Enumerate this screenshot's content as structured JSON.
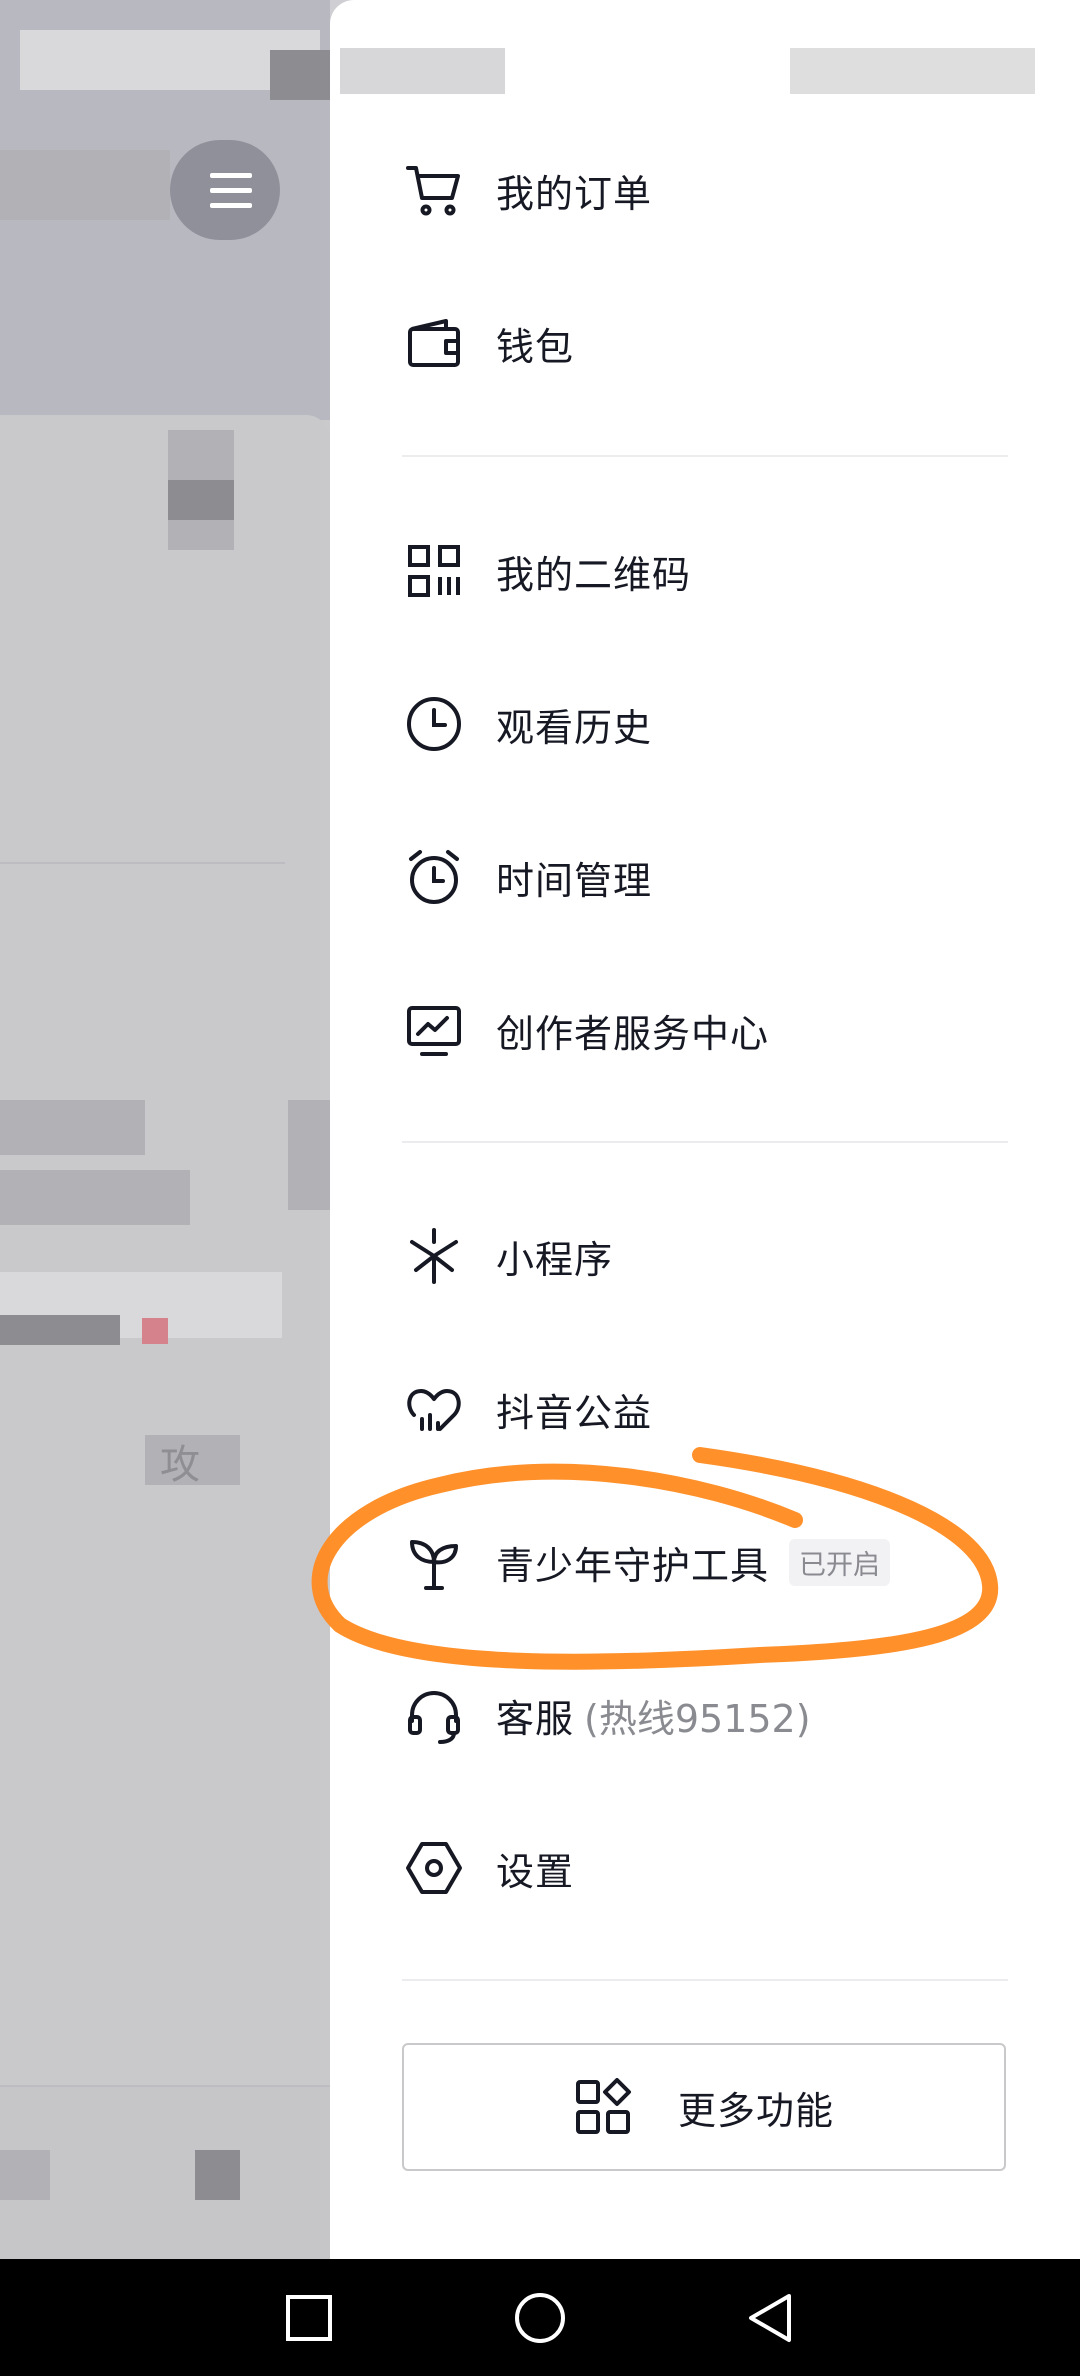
{
  "menu": {
    "items": [
      {
        "label": "我的订单",
        "icon": "cart-icon"
      },
      {
        "label": "钱包",
        "icon": "wallet-icon"
      },
      {
        "label": "我的二维码",
        "icon": "qr-code-icon"
      },
      {
        "label": "观看历史",
        "icon": "clock-icon"
      },
      {
        "label": "时间管理",
        "icon": "alarm-clock-icon"
      },
      {
        "label": "创作者服务中心",
        "icon": "creator-monitor-icon"
      },
      {
        "label": "小程序",
        "icon": "mini-program-icon"
      },
      {
        "label": "抖音公益",
        "icon": "charity-heart-icon"
      },
      {
        "label": "青少年守护工具",
        "icon": "sprout-icon",
        "badge": "已开启"
      },
      {
        "label": "客服",
        "icon": "headset-icon",
        "sub": "(热线95152)"
      },
      {
        "label": "设置",
        "icon": "settings-hexagon-icon"
      }
    ],
    "more_button": {
      "label": "更多功能",
      "icon": "apps-grid-icon"
    }
  },
  "background_app": {
    "partial_text": "攻"
  },
  "annotation": {
    "color": "#FF8A1F"
  },
  "navbar": {
    "buttons": [
      "square-recents-icon",
      "circle-home-icon",
      "triangle-back-icon"
    ]
  }
}
